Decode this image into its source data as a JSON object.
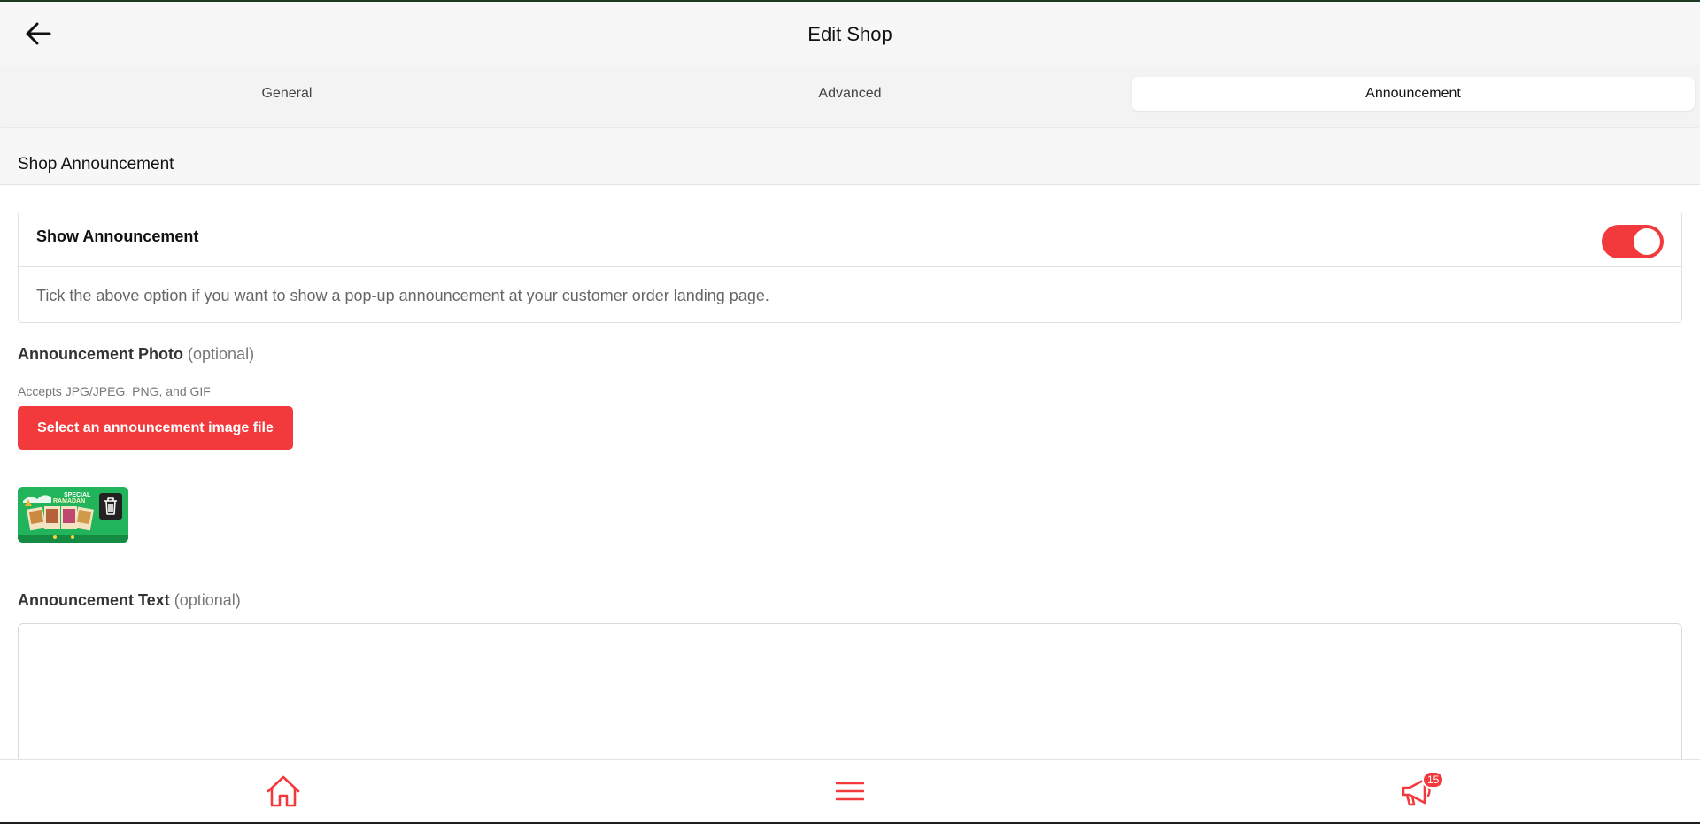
{
  "header": {
    "title": "Edit Shop",
    "back_icon": "arrow-left-icon"
  },
  "tabs": [
    {
      "label": "General",
      "active": false
    },
    {
      "label": "Advanced",
      "active": false
    },
    {
      "label": "Announcement",
      "active": true
    }
  ],
  "section": {
    "title": "Shop Announcement"
  },
  "show_announcement": {
    "label": "Show Announcement",
    "enabled": true,
    "help": "Tick the above option if you want to show a pop-up announcement at your customer order landing page."
  },
  "photo": {
    "label": "Announcement Photo",
    "optional": "(optional)",
    "accepts": "Accepts JPG/JPEG, PNG, and GIF",
    "button": "Select an announcement image file",
    "thumb_text_1": "SPECIAL",
    "thumb_text_2": "RAMADAN"
  },
  "text": {
    "label": "Announcement Text",
    "optional": "(optional)",
    "value": ""
  },
  "bottom_nav": {
    "home_icon": "home-icon",
    "menu_icon": "hamburger-menu-icon",
    "announcement_icon": "megaphone-icon",
    "badge_count": "15"
  },
  "colors": {
    "accent": "#f23a3c",
    "header_bg": "#f7f7f7",
    "tab_bg": "#f3f3f3"
  }
}
